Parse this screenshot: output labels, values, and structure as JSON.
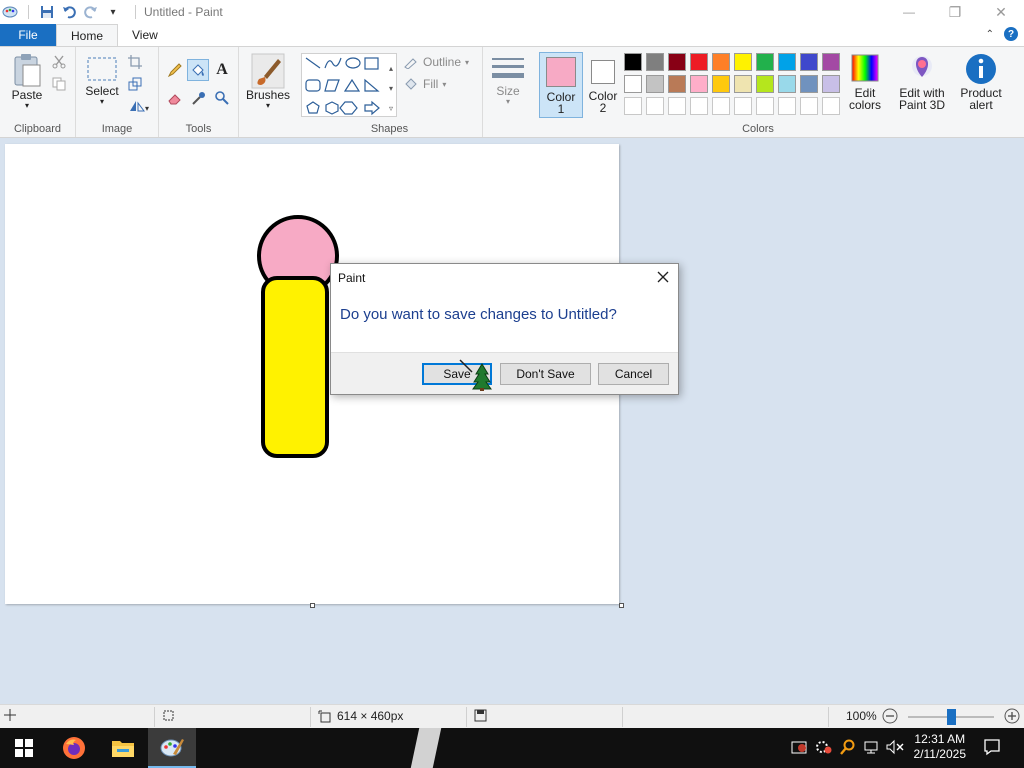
{
  "window": {
    "title": "Untitled - Paint",
    "minimize_glyph": "—",
    "maximize_glyph": "❐",
    "close_glyph": "✕"
  },
  "tabs": {
    "file": "File",
    "home": "Home",
    "view": "View"
  },
  "ribbon": {
    "clipboard": {
      "label": "Clipboard",
      "paste": "Paste"
    },
    "image": {
      "label": "Image",
      "select": "Select"
    },
    "tools": {
      "label": "Tools"
    },
    "brushes": {
      "label": "Brushes"
    },
    "shapes": {
      "label": "Shapes",
      "outline": "Outline",
      "fill": "Fill"
    },
    "size": {
      "label": "Size"
    },
    "color1": {
      "line1": "Color",
      "line2": "1",
      "color": "#f7aac5"
    },
    "color2": {
      "line1": "Color",
      "line2": "2",
      "color": "#ffffff"
    },
    "colors": {
      "label": "Colors",
      "row1": [
        "#000000",
        "#7f7f7f",
        "#880015",
        "#ed1c24",
        "#ff7f27",
        "#fff200",
        "#22b14c",
        "#00a2e8",
        "#3f48cc",
        "#a349a4"
      ],
      "row2": [
        "#ffffff",
        "#c3c3c3",
        "#b97a57",
        "#ffaec9",
        "#ffc90e",
        "#efe4b0",
        "#b5e61d",
        "#99d9ea",
        "#7092be",
        "#c8bfe7"
      ]
    },
    "edit_colors": {
      "line1": "Edit",
      "line2": "colors"
    },
    "edit_paint3d": {
      "line1": "Edit with",
      "line2": "Paint 3D"
    },
    "product_alert": {
      "line1": "Product",
      "line2": "alert"
    }
  },
  "dialog": {
    "title": "Paint",
    "message": "Do you want to save changes to Untitled?",
    "save": "Save",
    "dont_save": "Don't Save",
    "cancel": "Cancel"
  },
  "statusbar": {
    "dimensions": "614 × 460px",
    "zoom": "100%",
    "zoom_level": 0.5
  },
  "taskbar": {
    "time": "12:31 AM",
    "date": "2/11/2025"
  }
}
